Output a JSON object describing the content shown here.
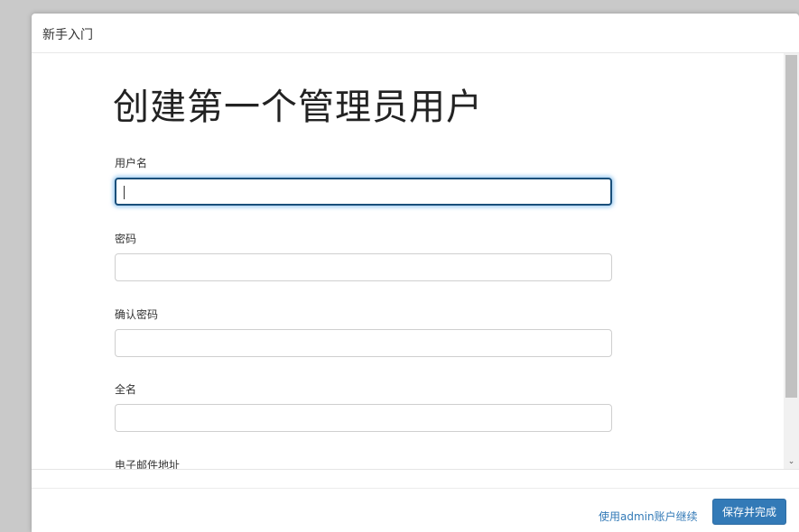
{
  "dialog": {
    "title": "新手入门"
  },
  "form": {
    "heading": "创建第一个管理员用户",
    "fields": [
      {
        "label": "用户名",
        "value": ""
      },
      {
        "label": "密码",
        "value": ""
      },
      {
        "label": "确认密码",
        "value": ""
      },
      {
        "label": "全名",
        "value": ""
      },
      {
        "label": "电子邮件地址",
        "value": ""
      }
    ]
  },
  "footer": {
    "continue_link": "使用admin账户继续",
    "save_button": "保存并完成"
  },
  "colors": {
    "primary": "#337ab7",
    "focus_border": "#1a4f7a"
  },
  "icons": {
    "scroll_down": "chevron-down-icon"
  }
}
